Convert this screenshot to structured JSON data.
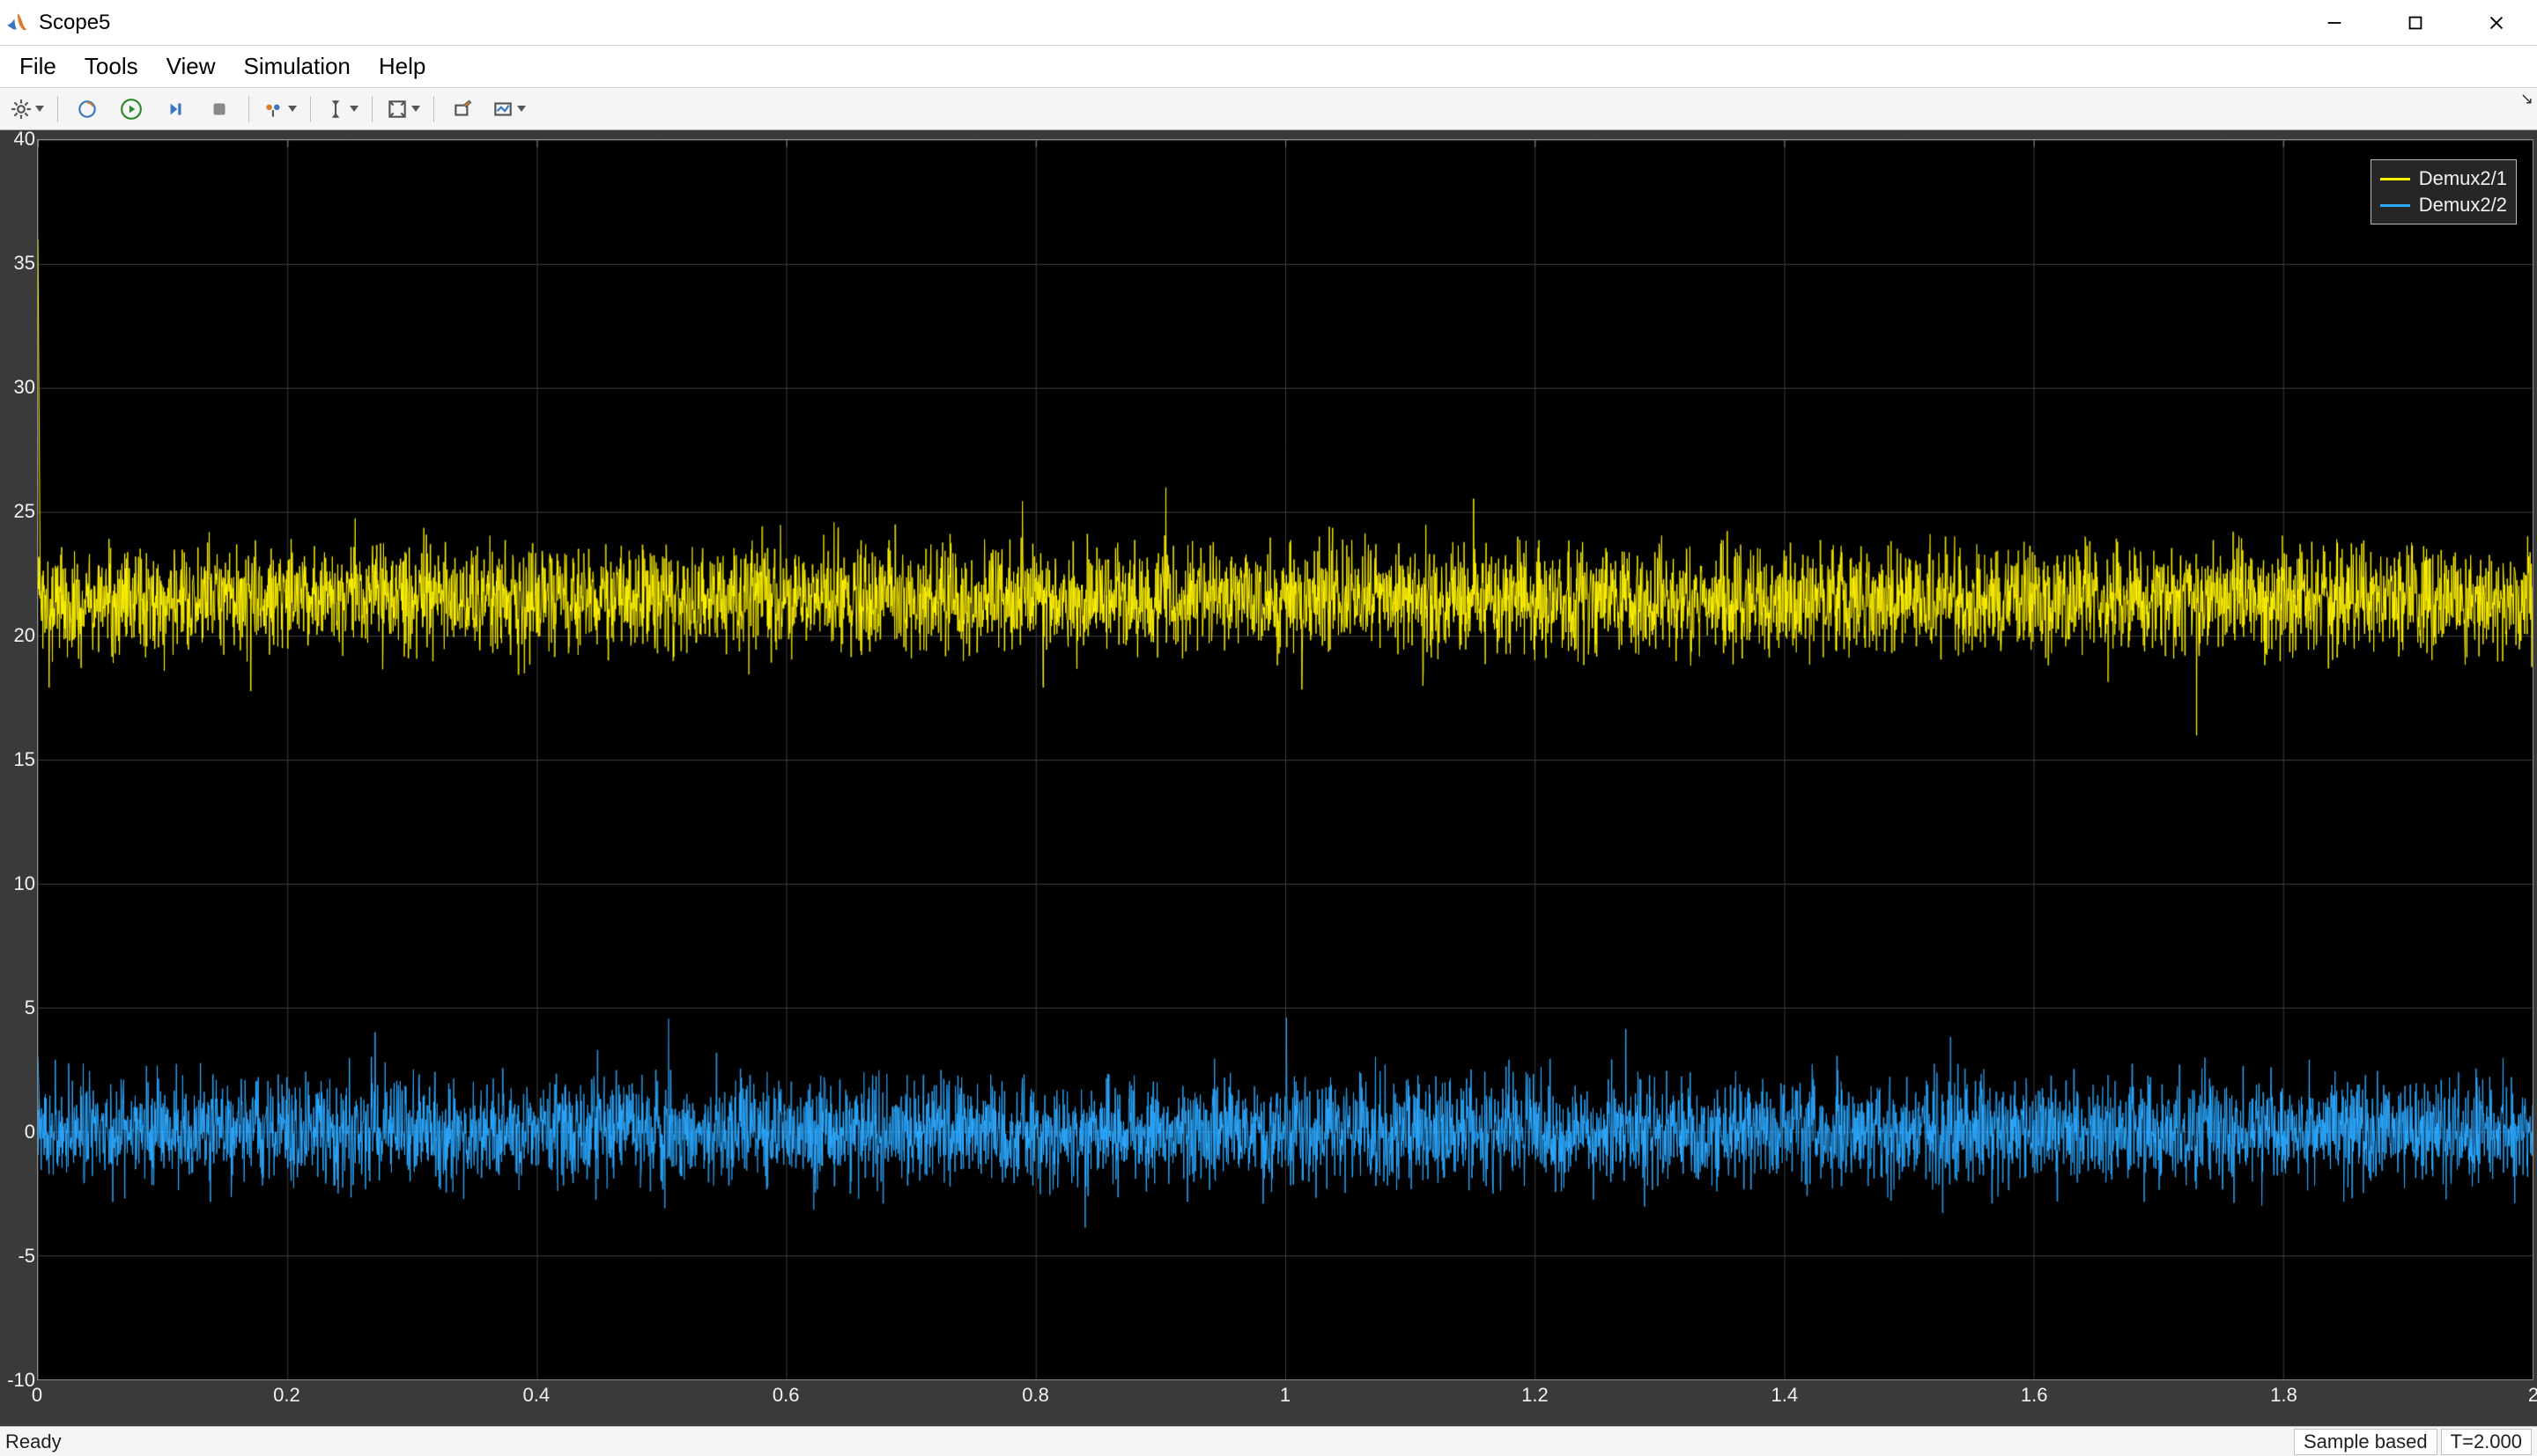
{
  "window": {
    "title": "Scope5"
  },
  "menubar": {
    "items": [
      "File",
      "Tools",
      "View",
      "Simulation",
      "Help"
    ]
  },
  "toolbar": {
    "config_tip": "Configuration Properties",
    "print_tip": "Print",
    "run_tip": "Run",
    "step_tip": "Step Forward",
    "stop_tip": "Stop",
    "triggers_tip": "Triggers",
    "cursor_tip": "Cursor Measurements",
    "autoscale_tip": "Scale Axes Limits",
    "floating_tip": "Floating Scope",
    "highlight_tip": "Highlight Signal"
  },
  "corner": {
    "glyph": "↘"
  },
  "legend": {
    "items": [
      {
        "label": "Demux2/1",
        "color": "#fff200"
      },
      {
        "label": "Demux2/2",
        "color": "#2ca8ff"
      }
    ]
  },
  "axes": {
    "y_ticks": [
      "40",
      "35",
      "30",
      "25",
      "20",
      "15",
      "10",
      "5",
      "0",
      "-5",
      "-10"
    ],
    "x_ticks": [
      "0",
      "0.2",
      "0.4",
      "0.6",
      "0.8",
      "1",
      "1.2",
      "1.4",
      "1.6",
      "1.8",
      "2"
    ]
  },
  "status": {
    "left": "Ready",
    "right1": "Sample based",
    "right2": "T=2.000"
  },
  "chart_data": {
    "type": "line",
    "title": "",
    "xlabel": "",
    "ylabel": "",
    "xlim": [
      0,
      2
    ],
    "ylim": [
      -10,
      40
    ],
    "x_ticks": [
      0,
      0.2,
      0.4,
      0.6,
      0.8,
      1.0,
      1.2,
      1.4,
      1.6,
      1.8,
      2.0
    ],
    "y_ticks": [
      -10,
      -5,
      0,
      5,
      10,
      15,
      20,
      25,
      30,
      35,
      40
    ],
    "grid": true,
    "legend_position": "upper-right",
    "series": [
      {
        "name": "Demux2/1",
        "color": "#fff200",
        "description": "Dense noisy signal (~20 kHz-like density), mean ≈ 21.5, peak-to-peak amplitude ≈ 4, occasional spikes up to ≈ 26 and down to ≈ 18; brief initial transient near t=0 reaching ≈ 36.",
        "mean": 21.5,
        "amplitude_pk": 2.0,
        "initial_spike": 36
      },
      {
        "name": "Demux2/2",
        "color": "#2ca8ff",
        "description": "Dense noisy signal, mean ≈ 0, peak-to-peak amplitude ≈ 4, occasional spikes to ≈ ±3; brief initial transient near t=0 reaching ≈ 3.",
        "mean": 0.0,
        "amplitude_pk": 2.0,
        "initial_spike": 3
      }
    ]
  }
}
